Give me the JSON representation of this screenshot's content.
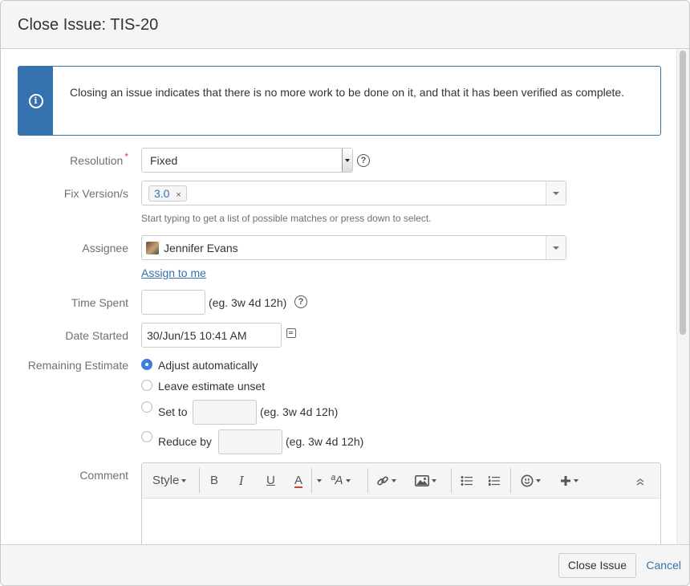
{
  "dialog": {
    "title": "Close Issue:  TIS-20",
    "info_message": "Closing an issue indicates that there is no more work to be done on it, and that it has been verified as complete.",
    "info_icon": "info-icon"
  },
  "form": {
    "resolution": {
      "label": "Resolution",
      "required_marker": "*",
      "value": "Fixed",
      "help_icon": "question-circle-icon"
    },
    "fix_versions": {
      "label": "Fix Version/s",
      "tags": [
        {
          "label": "3.0",
          "remove": "×"
        }
      ],
      "hint": "Start typing to get a list of possible matches or press down to select."
    },
    "assignee": {
      "label": "Assignee",
      "value": "Jennifer Evans",
      "assign_to_me": "Assign to me"
    },
    "time_spent": {
      "label": "Time Spent",
      "value": "",
      "hint": "(eg. 3w 4d 12h)",
      "help_icon": "question-circle-icon"
    },
    "date_started": {
      "label": "Date Started",
      "value": "30/Jun/15 10:41 AM",
      "calendar_icon": "calendar-icon"
    },
    "remaining_estimate": {
      "label": "Remaining Estimate",
      "options": [
        {
          "label": "Adjust automatically",
          "checked": true
        },
        {
          "label": "Leave estimate unset",
          "checked": false
        },
        {
          "label": "Set to",
          "checked": false,
          "hint": "(eg. 3w 4d 12h)"
        },
        {
          "label": "Reduce by",
          "checked": false,
          "hint": "(eg. 3w 4d 12h)"
        }
      ]
    },
    "comment": {
      "label": "Comment",
      "toolbar": {
        "style": "Style",
        "bold": "B",
        "italic": "I",
        "underline": "U",
        "color": "A",
        "format": "ªA"
      }
    }
  },
  "colors": {
    "accent": "#3572b0",
    "required": "#d04437",
    "radio_checked": "#3b7fe0",
    "text_color_underline": "#d04437"
  },
  "footer": {
    "submit": "Close Issue",
    "cancel": "Cancel"
  }
}
